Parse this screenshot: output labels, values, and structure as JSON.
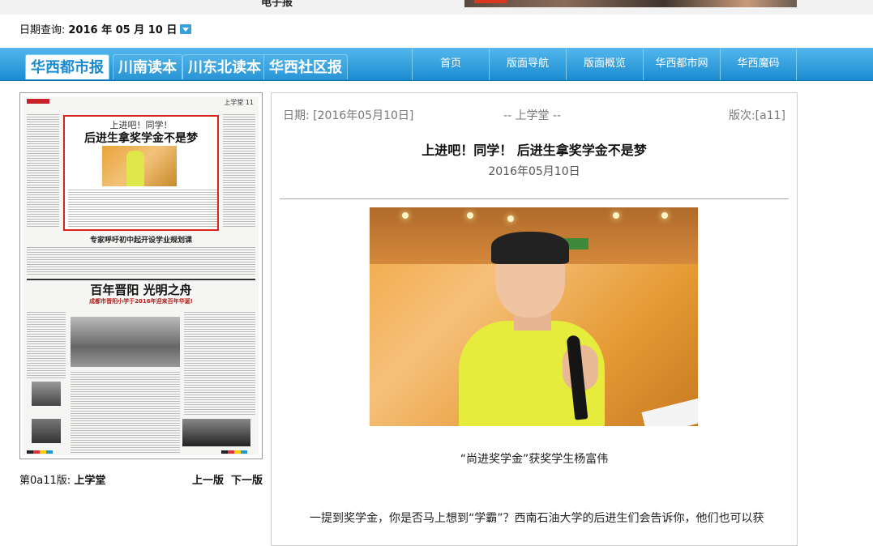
{
  "top": {
    "cut_text": "电子报"
  },
  "date_query": {
    "label": "日期查询:",
    "value": "2016 年 05 月 10 日"
  },
  "nav": {
    "paper_tabs": [
      "华西都市报",
      "川南读本",
      "川东北读本",
      "华西社区报"
    ],
    "links": [
      "首页",
      "版面导航",
      "版面概览",
      "华西都市网",
      "华西魔码"
    ]
  },
  "page_thumb": {
    "section_label": "上学堂 11",
    "kicker": "上进吧！同学！",
    "headline": "后进生拿奖学金不是梦",
    "subhead": "专家呼吁初中起开设学业规划课",
    "big_headline": "百年晋阳  光明之舟",
    "red_line": "成都市晋阳小学于2016年迎来百年华诞!"
  },
  "page_footer": {
    "label": "第0a11版:",
    "section": "上学堂",
    "prev": "上一版",
    "next": "下一版"
  },
  "article": {
    "date_meta": "日期: [2016年05月10日]",
    "section_meta": "-- 上学堂 --",
    "page_meta": "版次:[a11]",
    "title": "上进吧！同学！ 后进生拿奖学金不是梦",
    "date": "2016年05月10日",
    "caption": "“尚进奖学金”获奖学生杨富伟",
    "paragraph": "一提到奖学金，你是否马上想到“学霸”？西南石油大学的后进生们会告诉你，他们也可以获"
  },
  "colors": {
    "nav_blue": "#1a8bd1",
    "highlight_red": "#d9261c"
  }
}
